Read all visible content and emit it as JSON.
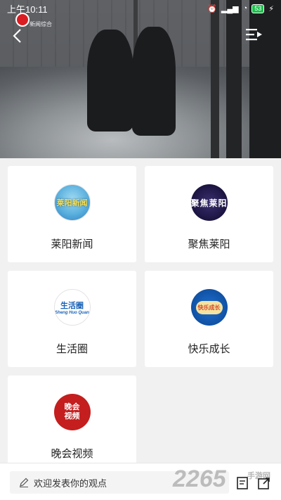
{
  "status_bar": {
    "time": "上午10:11",
    "battery": "53"
  },
  "video": {
    "channel_logo_text": "新闻综合"
  },
  "cards": [
    {
      "label": "莱阳新闻",
      "icon": "laiyang-news-logo",
      "icon_text": "莱阳新闻"
    },
    {
      "label": "聚焦莱阳",
      "icon": "focus-laiyang-logo",
      "icon_text": "聚焦莱阳"
    },
    {
      "label": "生活圈",
      "icon": "life-circle-logo",
      "icon_text": "生活圈",
      "icon_subtext": "Sheng Huo Quan"
    },
    {
      "label": "快乐成长",
      "icon": "happy-growth-logo",
      "icon_text": "快乐成长"
    },
    {
      "label": "晚会视频",
      "icon": "gala-video-logo",
      "icon_text_1": "晚会",
      "icon_text_2": "视频"
    }
  ],
  "bottom_bar": {
    "comment_placeholder": "欢迎发表你的观点",
    "watermark": "2265",
    "watermark_sub": "手游网"
  },
  "colors": {
    "accent_red": "#c41e1e",
    "card_bg": "#ffffff",
    "page_bg": "#f1f1f1"
  }
}
